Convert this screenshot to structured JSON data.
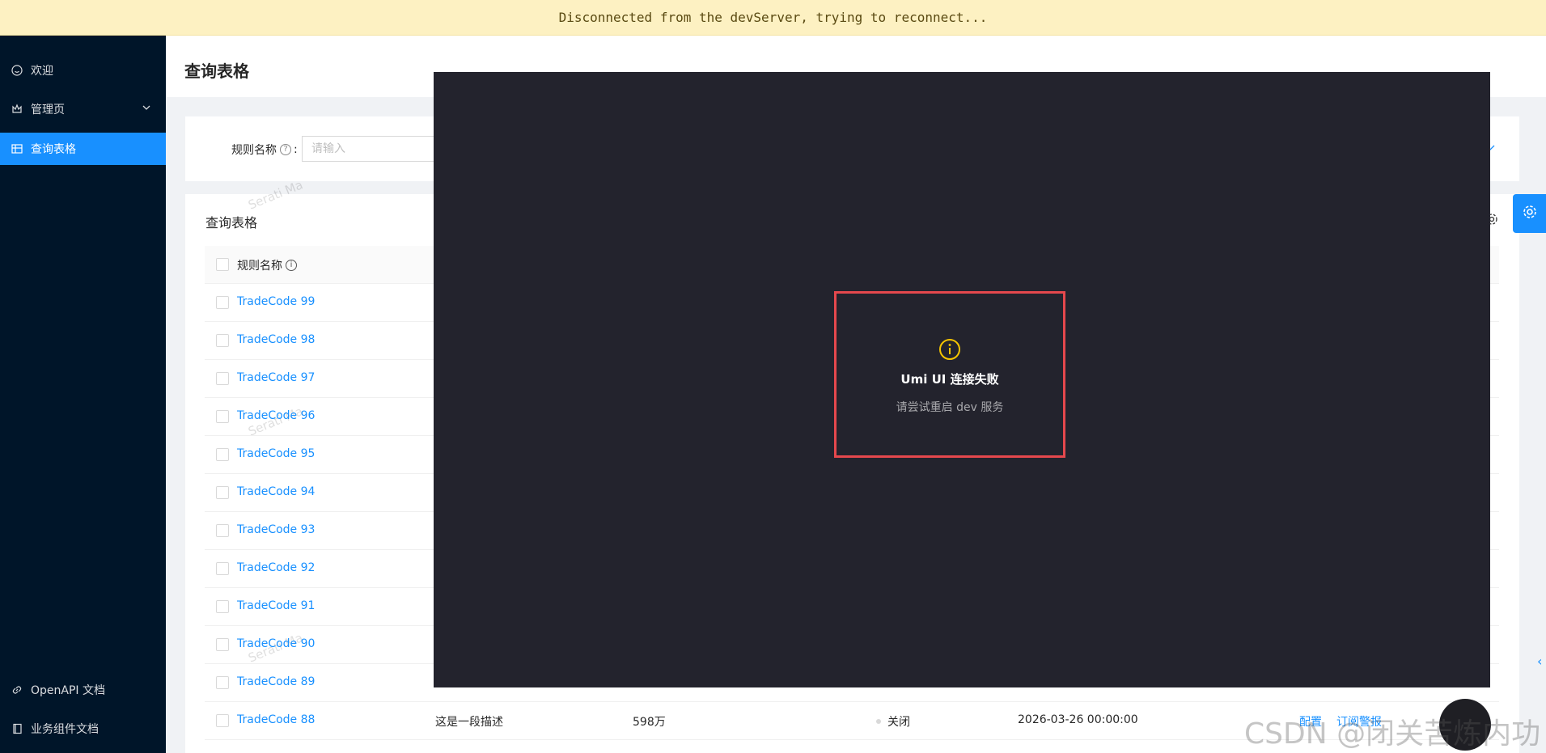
{
  "banner": {
    "text": "Disconnected from the devServer, trying to reconnect..."
  },
  "sidebar": {
    "items": [
      {
        "label": "欢迎",
        "icon": "smile-icon"
      },
      {
        "label": "管理页",
        "icon": "crown-icon"
      },
      {
        "label": "查询表格",
        "icon": "table-icon",
        "active": true
      }
    ],
    "footer": [
      {
        "label": "OpenAPI 文档",
        "icon": "link-icon"
      },
      {
        "label": "业务组件文档",
        "icon": "book-icon"
      }
    ]
  },
  "header": {
    "title": "查询表格"
  },
  "search": {
    "label": "规则名称",
    "colon": ":",
    "placeholder": "请输入"
  },
  "table": {
    "title": "查询表格",
    "column_name": "规则名称",
    "rows": [
      {
        "name": "TradeCode 99"
      },
      {
        "name": "TradeCode 98"
      },
      {
        "name": "TradeCode 97"
      },
      {
        "name": "TradeCode 96"
      },
      {
        "name": "TradeCode 95"
      },
      {
        "name": "TradeCode 94"
      },
      {
        "name": "TradeCode 93"
      },
      {
        "name": "TradeCode 92"
      },
      {
        "name": "TradeCode 91"
      },
      {
        "name": "TradeCode 90"
      },
      {
        "name": "TradeCode 89"
      },
      {
        "name": "TradeCode 88",
        "desc": "这是一段描述",
        "calls": "598万",
        "status": "关闭",
        "time": "2026-03-26 00:00:00",
        "action_config": "配置",
        "action_subscribe": "订阅警报"
      }
    ]
  },
  "watermark": {
    "text": "Serati Ma"
  },
  "overlay": {
    "title": "Umi UI 连接失败",
    "subtitle": "请尝试重启 dev 服务",
    "accent": "#f5c400",
    "border": "#e5484d"
  },
  "csdn": {
    "text": "CSDN @闭关苦炼内功"
  },
  "colors": {
    "primary": "#1890ff",
    "sider": "#001529",
    "banner": "#fdf1c2"
  }
}
